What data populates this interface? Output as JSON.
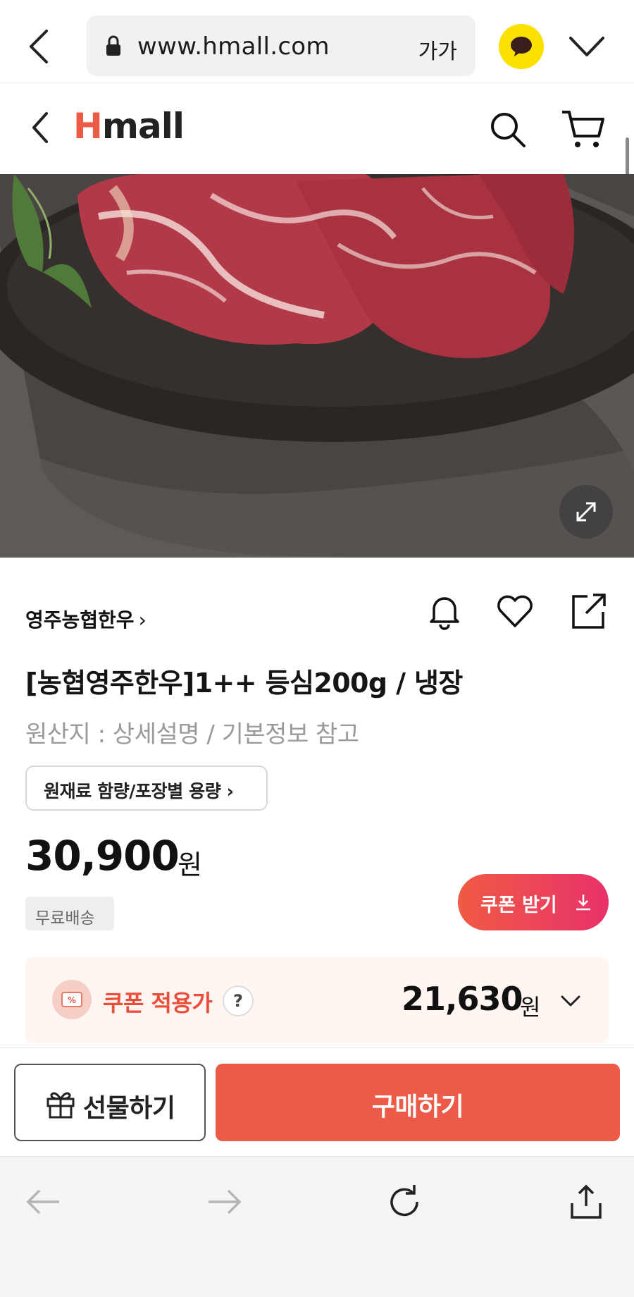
{
  "browser": {
    "url": "www.hmall.com",
    "text_size_label": "가가"
  },
  "header": {
    "logo_first": "H",
    "logo_rest": "mall"
  },
  "product": {
    "brand": "영주농협한우",
    "brand_chevron": "›",
    "title": "[농협영주한우]1++ 등심200g / 냉장",
    "origin": "원산지 : 상세설명 / 기본정보 참고",
    "raw_info_button": "원재료 함량/포장별 용량 ›",
    "price": "30,900",
    "price_unit": "원",
    "shipping_badge": "무료배송",
    "coupon_button": "쿠폰 받기"
  },
  "coupon": {
    "label": "쿠폰 적용가",
    "help": "?",
    "price": "21,630",
    "unit": "원"
  },
  "actions": {
    "gift": "선물하기",
    "buy": "구매하기"
  },
  "colors": {
    "brand_accent": "#ec5b45",
    "buy_button": "#ec5b47",
    "coupon_text": "#ec4d3b",
    "kakao_yellow": "#fae100"
  },
  "icons": [
    "back-icon",
    "lock-icon",
    "kakao-talk-icon",
    "chevron-down-icon",
    "search-icon",
    "cart-icon",
    "expand-icon",
    "bell-icon",
    "heart-icon",
    "share-icon",
    "download-icon",
    "coupon-percent-icon",
    "gift-icon",
    "reload-icon",
    "upload-icon"
  ]
}
